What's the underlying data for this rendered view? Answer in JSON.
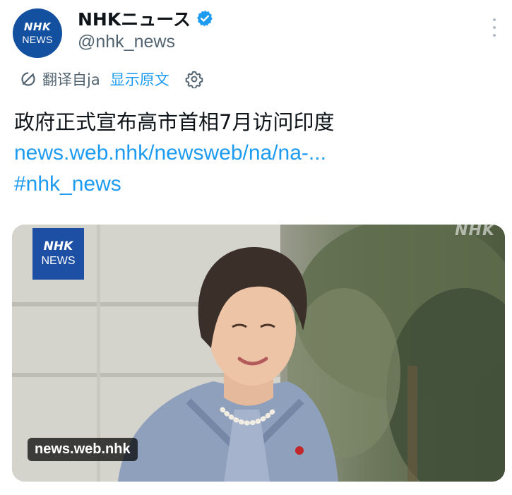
{
  "account": {
    "display_name": "NHKニュース",
    "handle": "@nhk_news",
    "avatar_line1": "NHK",
    "avatar_line2": "NEWS",
    "verified": true
  },
  "translation": {
    "translated_from": "翻译自ja",
    "show_original": "显示原文"
  },
  "tweet": {
    "text": "政府正式宣布高市首相7月访问印度",
    "link": "news.web.nhk/newsweb/na/na-...",
    "hashtag": "#nhk_news"
  },
  "media": {
    "logo_line1": "NHK",
    "logo_line2": "NEWS",
    "watermark": "NHK",
    "domain_label": "news.web.nhk"
  },
  "icons": {
    "verified": "verified-badge-icon",
    "translate": "translate-icon",
    "settings": "gear-icon",
    "more": "more-options-icon"
  },
  "colors": {
    "link": "#1d9bf0",
    "secondary_text": "#536471",
    "brand": "#1450a0"
  }
}
